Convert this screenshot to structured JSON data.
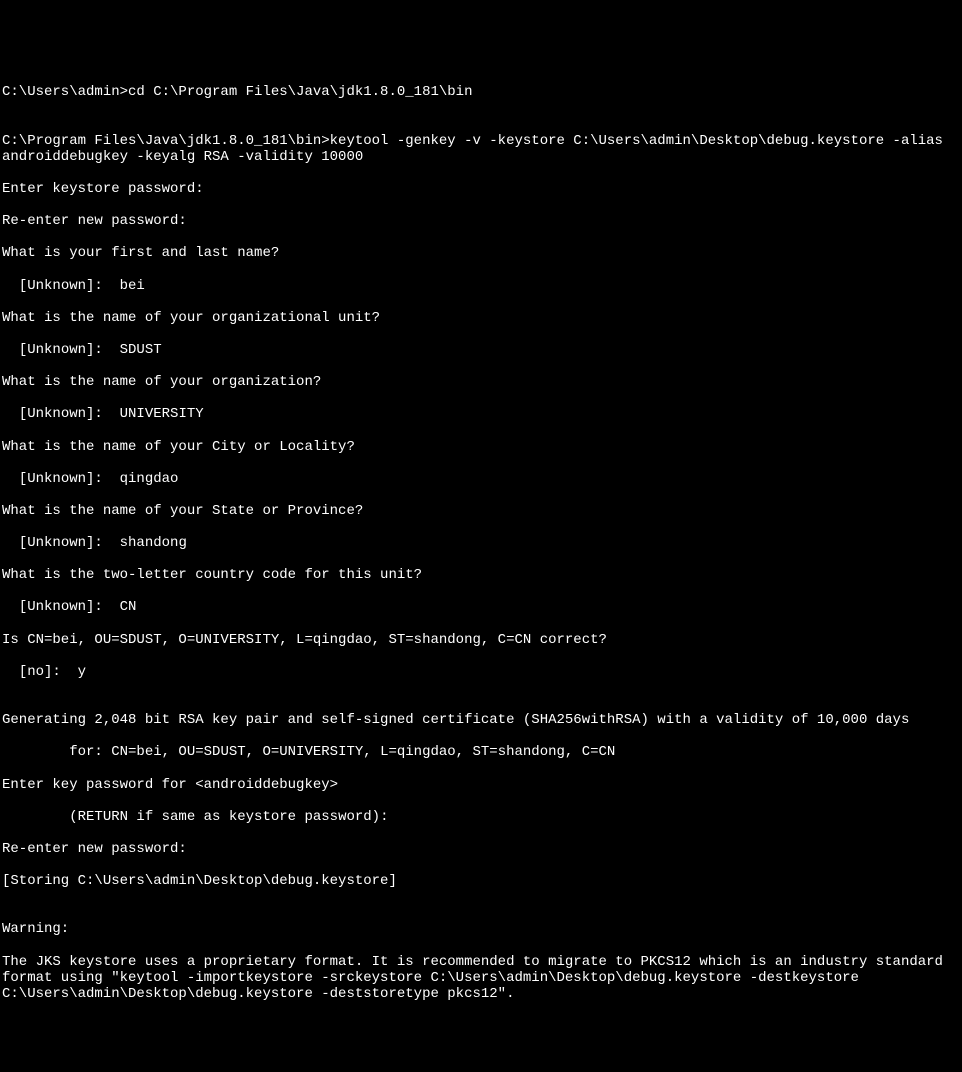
{
  "terminal": {
    "lines": [
      "C:\\Users\\admin>cd C:\\Program Files\\Java\\jdk1.8.0_181\\bin",
      "",
      "C:\\Program Files\\Java\\jdk1.8.0_181\\bin>keytool -genkey -v -keystore C:\\Users\\admin\\Desktop\\debug.keystore -alias androiddebugkey -keyalg RSA -validity 10000",
      "Enter keystore password:",
      "Re-enter new password:",
      "What is your first and last name?",
      "  [Unknown]:  bei",
      "What is the name of your organizational unit?",
      "  [Unknown]:  SDUST",
      "What is the name of your organization?",
      "  [Unknown]:  UNIVERSITY",
      "What is the name of your City or Locality?",
      "  [Unknown]:  qingdao",
      "What is the name of your State or Province?",
      "  [Unknown]:  shandong",
      "What is the two-letter country code for this unit?",
      "  [Unknown]:  CN",
      "Is CN=bei, OU=SDUST, O=UNIVERSITY, L=qingdao, ST=shandong, C=CN correct?",
      "  [no]:  y",
      "",
      "Generating 2,048 bit RSA key pair and self-signed certificate (SHA256withRSA) with a validity of 10,000 days",
      "        for: CN=bei, OU=SDUST, O=UNIVERSITY, L=qingdao, ST=shandong, C=CN",
      "Enter key password for <androiddebugkey>",
      "        (RETURN if same as keystore password):",
      "Re-enter new password:",
      "[Storing C:\\Users\\admin\\Desktop\\debug.keystore]",
      "",
      "Warning:",
      "The JKS keystore uses a proprietary format. It is recommended to migrate to PKCS12 which is an industry standard format using \"keytool -importkeystore -srckeystore C:\\Users\\admin\\Desktop\\debug.keystore -destkeystore C:\\Users\\admin\\Desktop\\debug.keystore -deststoretype pkcs12\"."
    ]
  }
}
